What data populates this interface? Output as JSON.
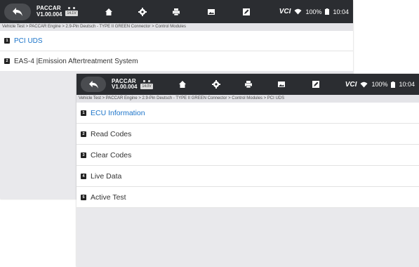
{
  "colors": {
    "topbar": "#2b2d31",
    "accent_blue": "#1a73c9",
    "list_bg": "#ffffff",
    "panel_bg": "#e9e9ec"
  },
  "back_screen": {
    "header": {
      "brand": "PACCAR",
      "version": "V1.00.004",
      "battery_chip": "14.1V",
      "icons": [
        "back-icon",
        "home-icon",
        "settings-icon",
        "print-icon",
        "image-icon",
        "edit-icon"
      ],
      "vci_label": "VCI",
      "wifi_icon": "wifi-icon",
      "battery_pct": "100%",
      "time": "10:04"
    },
    "breadcrumb": "Vehicle Test > PACCAR Engine > 2.9-Pin Deutsch - TYPE II GREEN Connector > Control Modules",
    "items": [
      {
        "num": "1",
        "label": "PCI UDS"
      },
      {
        "num": "2",
        "label": "EAS-4 |Emission Aftertreatment System"
      }
    ]
  },
  "front_screen": {
    "header": {
      "brand": "PACCAR",
      "version": "V1.00.004",
      "battery_chip": "14.0V",
      "icons": [
        "back-icon",
        "home-icon",
        "settings-icon",
        "print-icon",
        "image-icon",
        "edit-icon"
      ],
      "vci_label": "VCI",
      "wifi_icon": "wifi-icon",
      "battery_pct": "100%",
      "time": "10:04"
    },
    "breadcrumb": "Vehicle Test > PACCAR Engine > 2.9-Pin Deutsch - TYPE II GREEN Connector > Control Modules > PCI UDS",
    "items": [
      {
        "num": "1",
        "label": "ECU Information"
      },
      {
        "num": "2",
        "label": "Read Codes"
      },
      {
        "num": "3",
        "label": "Clear Codes"
      },
      {
        "num": "4",
        "label": "Live Data"
      },
      {
        "num": "5",
        "label": "Active Test"
      }
    ]
  }
}
